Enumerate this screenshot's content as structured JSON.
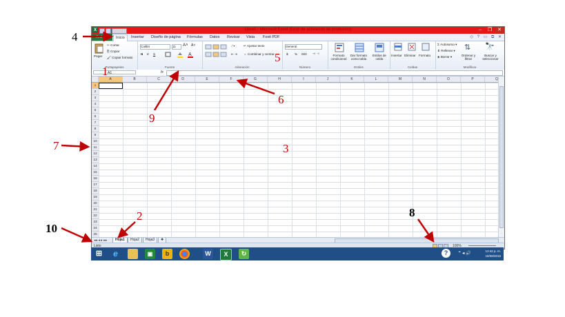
{
  "window": {
    "title": "Libro1 - Microsoft Excel (Error de activación de productos)",
    "app_icon": "X",
    "buttons": [
      "–",
      "❐",
      "✕"
    ]
  },
  "ribbon": {
    "tabs": [
      "Archivo",
      "Inicio",
      "Insertar",
      "Diseño de página",
      "Fórmulas",
      "Datos",
      "Revisar",
      "Vista",
      "Foxit PDF"
    ],
    "active_tab": "Inicio",
    "right_controls": "◇ ? ▭ ⧉ ✕",
    "groups": {
      "clipboard": {
        "label": "Portapapeles",
        "paste": "Pegar",
        "cut": "Cortar",
        "copy": "Copiar",
        "format_painter": "Copiar formato"
      },
      "font": {
        "label": "Fuente",
        "font_name": "Calibri",
        "font_size": "11",
        "bold": "N",
        "italic": "K",
        "underline": "S"
      },
      "alignment": {
        "label": "Alineación",
        "wrap": "Ajustar texto",
        "merge": "Combinar y centrar"
      },
      "number": {
        "label": "Número",
        "format": "General",
        "currency": "$",
        "percent": "%",
        "thousands": "000"
      },
      "styles": {
        "label": "Estilos",
        "conditional": "Formato condicional",
        "table": "Dar formato como tabla",
        "cell_styles": "Estilos de celda"
      },
      "cells": {
        "label": "Celdas",
        "insert": "Insertar",
        "delete": "Eliminar",
        "format": "Formato"
      },
      "editing": {
        "label": "Modificar",
        "autosum": "Autosuma",
        "fill": "Rellenar",
        "clear": "Borrar",
        "sort": "Ordenar y filtrar",
        "find": "Buscar y seleccionar"
      }
    }
  },
  "formula_bar": {
    "name_box": "A1",
    "fx": "fx",
    "value": ""
  },
  "grid": {
    "columns": [
      "A",
      "B",
      "C",
      "D",
      "E",
      "F",
      "G",
      "H",
      "I",
      "J",
      "K",
      "L",
      "M",
      "N",
      "O",
      "P",
      "Q"
    ],
    "rows": [
      "1",
      "2",
      "3",
      "4",
      "5",
      "6",
      "7",
      "8",
      "9",
      "10",
      "11",
      "12",
      "13",
      "14",
      "15",
      "16",
      "17",
      "18",
      "19",
      "20",
      "21",
      "22",
      "23",
      "24",
      "25"
    ],
    "active_cell": "A1"
  },
  "sheets": {
    "tabs": [
      "Hoja1",
      "Hoja2",
      "Hoja3"
    ],
    "active": "Hoja1"
  },
  "status_bar": {
    "text": "Listo",
    "zoom": "100%"
  },
  "taskbar": {
    "apps": [
      "windows-logo",
      "internet-explorer",
      "file-explorer",
      "store",
      "bing",
      "chrome",
      "word",
      "excel",
      "camtasia"
    ],
    "time": "12:42 p. m.",
    "date": "18/08/2016"
  },
  "annotations": {
    "n1": "1",
    "n2": "2",
    "n3": "3",
    "n4": "4",
    "n5": "5",
    "n6": "6",
    "n7": "7",
    "n8": "8",
    "n9": "9",
    "n10": "10"
  },
  "colors": {
    "title_bar": "#e81616",
    "file_tab": "#1f7a3c",
    "annotation": "#c00000",
    "taskbar": "#1f4f86",
    "selection": "#f6c77a"
  }
}
